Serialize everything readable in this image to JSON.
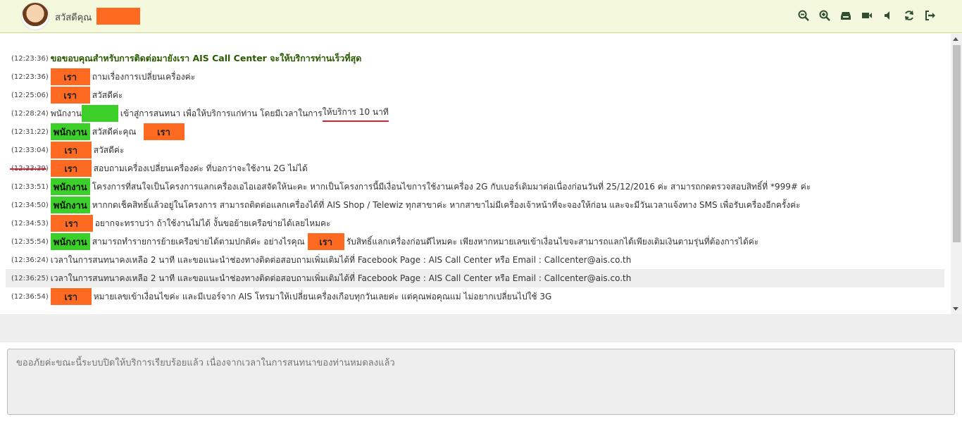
{
  "header": {
    "greeting": "สวัสดีคุณ",
    "icons": [
      "zoom-out-icon",
      "zoom-in-icon",
      "inbox-icon",
      "video-camera-icon",
      "volume-icon",
      "refresh-icon",
      "logout-icon"
    ]
  },
  "labels": {
    "me": "เรา",
    "agent": "พนักงาน"
  },
  "messages": [
    {
      "time": "(12:23:36)",
      "who": "system",
      "text": "ขอขอบคุณสำหรับการติดต่อมายังเรา AIS Call Center จะให้บริการท่านเร็วที่สุด"
    },
    {
      "time": "(12:23:36)",
      "who": "me",
      "text": "ถามเรื่องการเปลี่ยนเครื่องค่ะ"
    },
    {
      "time": "(12:25:06)",
      "who": "me",
      "text": "สวัสดีค่ะ"
    },
    {
      "time": "(12:28:24)",
      "who": "agent-join",
      "prefix": "พนักงาน",
      "text": "เข้าสู่การสนทนา เพื่อให้บริการแก่ท่าน โดยมีเวลาในการ",
      "underline": "ให้บริการ 10 นาที"
    },
    {
      "time": "(12:31:22)",
      "who": "agent",
      "text": "สวัสดีค่ะคุณ"
    },
    {
      "time": "(12:33:04)",
      "who": "me",
      "text": "สวัสดีค่ะ"
    },
    {
      "time": "(12:33:39)",
      "who": "me",
      "text": "สอบถามเครื่องเปลี่ยนเครื่องค่ะ ที่บอกว่าจะใช้งาน 2G ไม่ได้"
    },
    {
      "time": "(12:33:51)",
      "who": "agent",
      "text": "โครงการที่สนใจเป็นโครงการแลกเครื่องเอไอเอสจัดให้นะคะ หากเป็นโครงการนี้มีเงื่อนไขการใช้งานเครื่อง 2G กับเบอร์เดิมมาต่อเนื่องก่อนวันที่ 25/12/2016 ค่ะ สามารถกดตรวจสอบสิทธิ์ที่ *999# ค่ะ"
    },
    {
      "time": "(12:34:50)",
      "who": "agent",
      "text": "หากกดเช็คสิทธิ์แล้วอยู่ในโครงการ สามารถติดต่อแลกเครื่องได้ที่ AIS Shop / Telewiz ทุกสาขาค่ะ หากสาขาไม่มีเครื่องเจ้าหน้าที่จะจองให้ก่อน และจะมีวันเวลาแจ้งทาง SMS เพื่อรับเครื่องอีกครั้งค่ะ"
    },
    {
      "time": "(12:34:53)",
      "who": "me",
      "text": "อยากจะทราบว่า ถ้าใช้งานไม่ได้ งั้นขอย้ายเครือข่ายได้เลยไหมคะ"
    },
    {
      "time": "(12:35:54)",
      "who": "agent",
      "text": "สามารถทำรายการย้ายเครือข่ายได้ตามปกติค่ะ อย่างไรคุณ",
      "text2": "รับสิทธิ์แลกเครื่องก่อนดีไหมคะ เพียงหากหมายเลขเข้าเงื่อนไขจะสามารถแลกได้เพียงเติมเงินตามรุ่นที่ต้องการได้ค่ะ"
    },
    {
      "time": "(12:36:24)",
      "who": "system-plain",
      "text": "เวลาในการสนทนาคงเหลือ 2 นาที และขอแนะนำช่องทางติดต่อสอบถามเพิ่มเติมได้ที่ Facebook Page : AIS Call Center หรือ Email : Callcenter@ais.co.th"
    },
    {
      "time": "(12:36:25)",
      "who": "system-plain",
      "text": "เวลาในการสนทนาคงเหลือ 2 นาที และขอแนะนำช่องทางติดต่อสอบถามเพิ่มเติมได้ที่ Facebook Page : AIS Call Center หรือ Email : Callcenter@ais.co.th"
    },
    {
      "time": "(12:36:54)",
      "who": "me",
      "text": "หมายเลขเข้าเงื่อนไขค่ะ และมีเบอร์จาก AIS โทรมาให้เปลี่ยนเครื่องเกือบทุกวันเลยค่ะ แต่คุณพ่อคุณแม่ ไม่อยากเปลี่ยนไปใช้ 3G"
    }
  ],
  "input": {
    "placeholder": "ขออภัยค่ะขณะนี้ระบบปิดให้บริการเรียบร้อยแล้ว เนื่องจากเวลาในการสนทนาของท่านหมดลงแล้ว"
  },
  "colors": {
    "me": "#ff6a22",
    "agent": "#3ccf2a",
    "header_bg": "#f4f8dc"
  }
}
